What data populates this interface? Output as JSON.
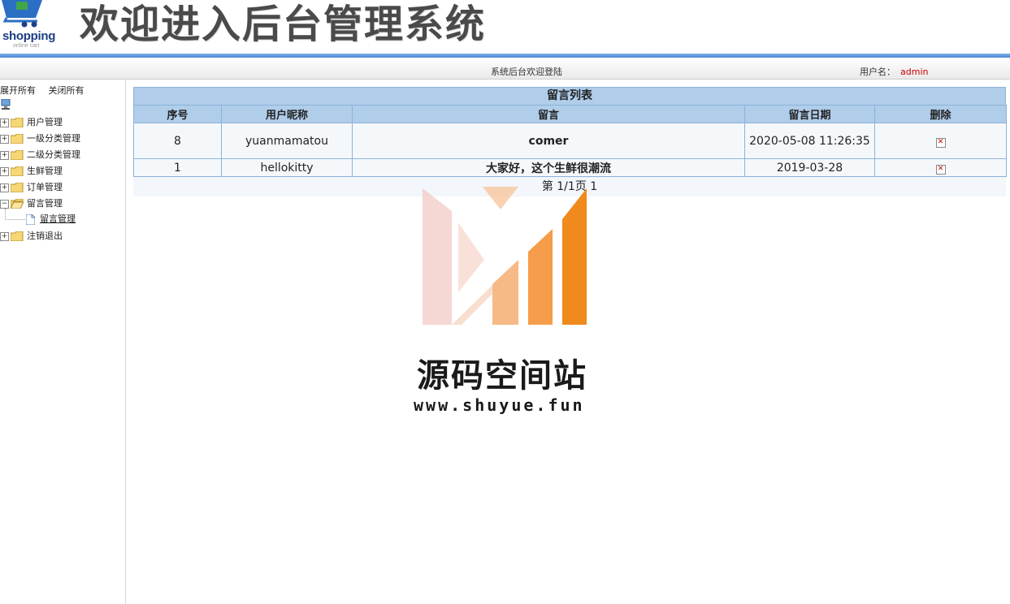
{
  "header": {
    "logo_word": "shopping",
    "logo_sub": "online cart",
    "title": "欢迎进入后台管理系统"
  },
  "topbar": {
    "welcome": "系统后台欢迎登陆",
    "user_label": "用户名：",
    "username": "admin"
  },
  "sidebar": {
    "expand_all": "展开所有",
    "close_all": "关闭所有",
    "items": [
      {
        "label": "用户管理",
        "expanded": false
      },
      {
        "label": "一级分类管理",
        "expanded": false
      },
      {
        "label": "二级分类管理",
        "expanded": false
      },
      {
        "label": "生鲜管理",
        "expanded": false
      },
      {
        "label": "订单管理",
        "expanded": false
      },
      {
        "label": "留言管理",
        "expanded": true
      },
      {
        "label": "注销退出",
        "expanded": false
      }
    ],
    "child": {
      "label": "留言管理"
    }
  },
  "main": {
    "list_title": "留言列表",
    "columns": [
      "序号",
      "用户昵称",
      "留言",
      "留言日期",
      "删除"
    ],
    "rows": [
      {
        "id": "8",
        "nickname": "yuanmamatou",
        "message": "comer",
        "date": "2020-05-08 11:26:35"
      },
      {
        "id": "1",
        "nickname": "hellokitty",
        "message": "大家好，这个生鲜很潮流",
        "date": "2019-03-28"
      }
    ],
    "pager": "第 1/1页 1"
  },
  "watermark": {
    "name": "源码空间站",
    "url": "www.shuyue.fun"
  },
  "colors": {
    "header_rule": "#4c87cf",
    "table_header": "#b0cdea",
    "message_text": "#a51414",
    "username": "#cc0000"
  }
}
